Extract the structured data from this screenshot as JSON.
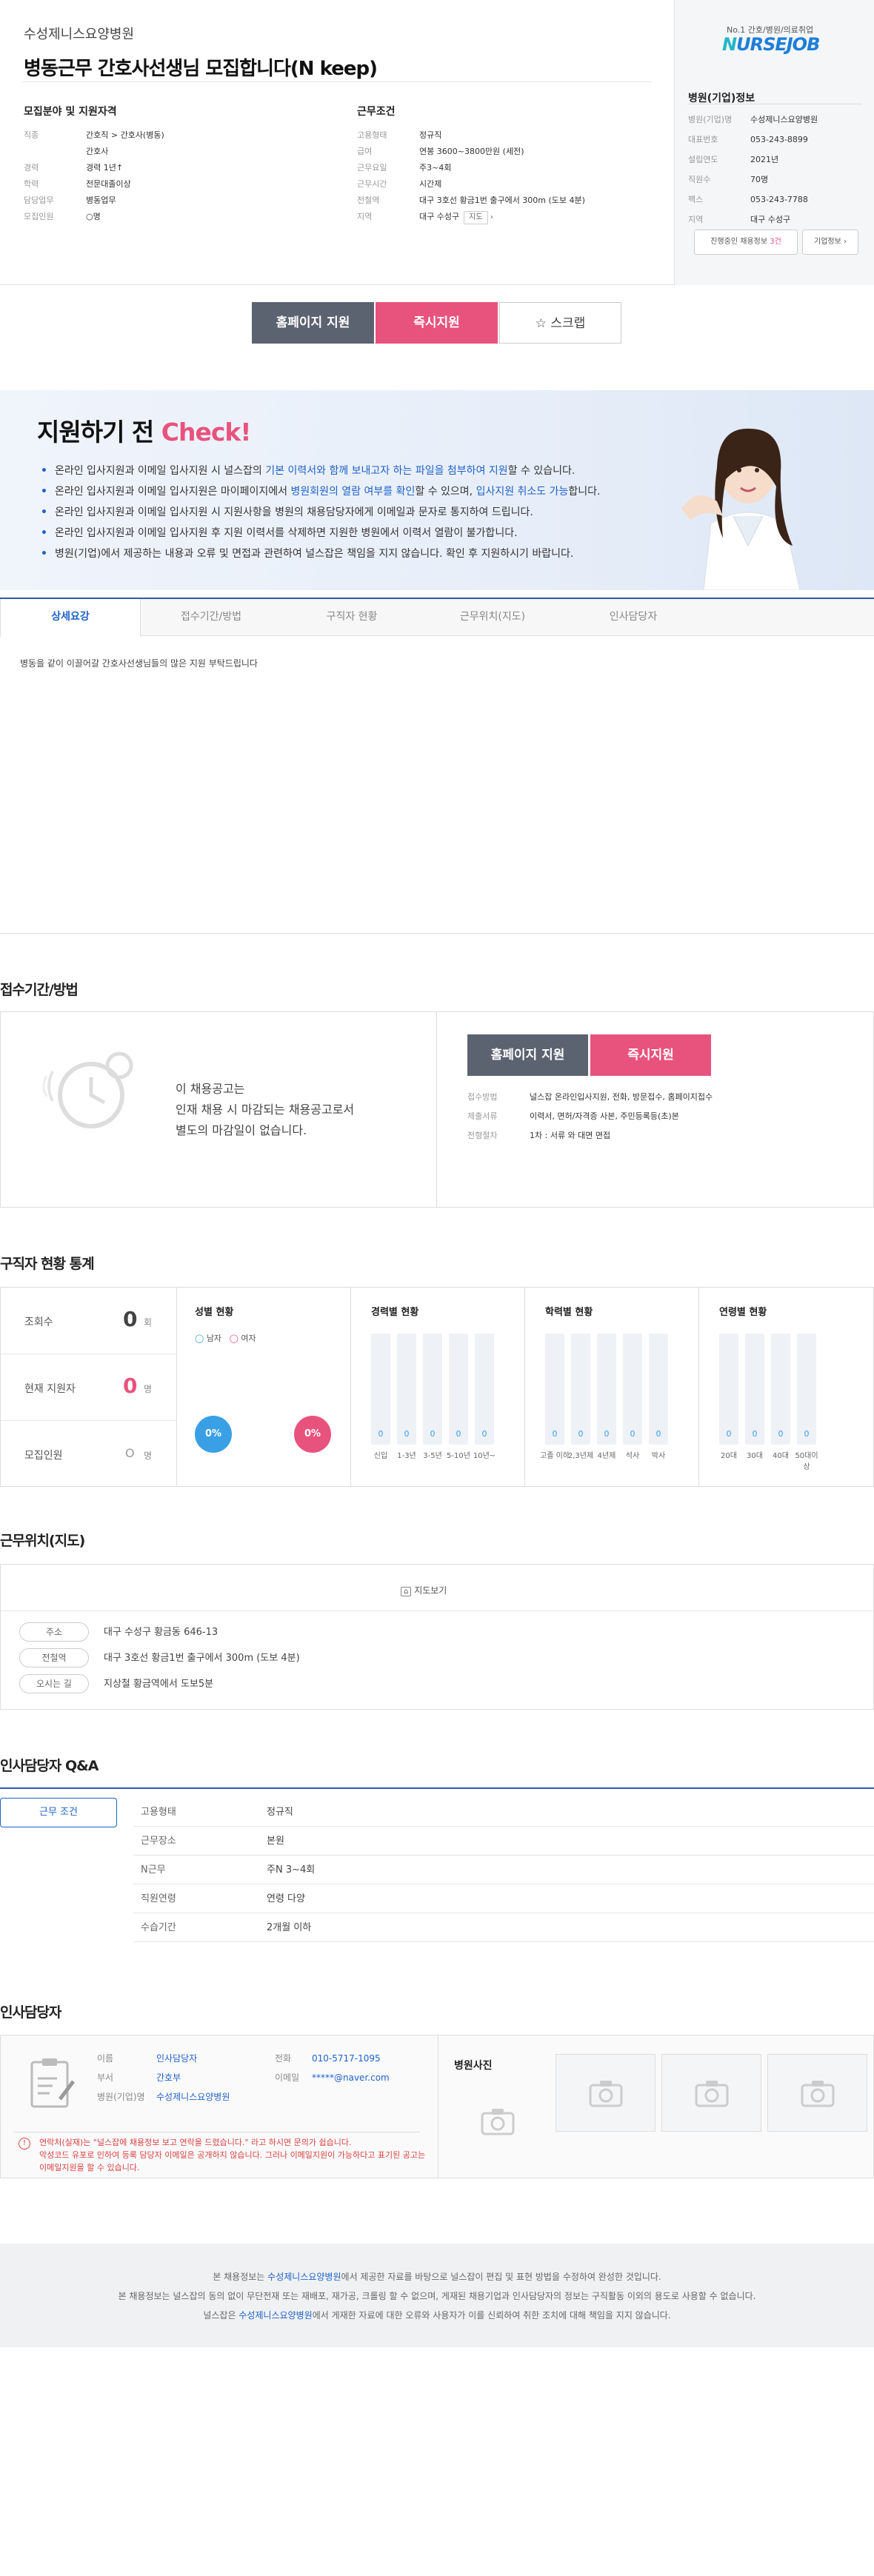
{
  "header": {
    "hospital_name": "수성제니스요양병원",
    "job_title": "병동근무 간호사선생님 모집합니다(N keep)"
  },
  "qualifications": {
    "heading": "모집분야 및 지원자격",
    "rows": [
      {
        "k": "직종",
        "v": "간호직 > 간호사(병동)"
      },
      {
        "k": "",
        "v": "간호사"
      },
      {
        "k": "경력",
        "v": "경력 1년↑"
      },
      {
        "k": "학력",
        "v": "전문대졸이상"
      },
      {
        "k": "담당업무",
        "v": "병동업무"
      },
      {
        "k": "모집인원",
        "v": "○명"
      }
    ]
  },
  "conditions": {
    "heading": "근무조건",
    "rows": [
      {
        "k": "고용형태",
        "v": "정규직"
      },
      {
        "k": "급여",
        "v": "연봉 3600~3800만원 (세전)"
      },
      {
        "k": "근무요일",
        "v": "주3~4회"
      },
      {
        "k": "근무시간",
        "v": "시간제"
      },
      {
        "k": "전철역",
        "v_highlight": "대구 3호선",
        "v": " 황금1번 출구에서 300m (도보 4분)"
      },
      {
        "k": "지역",
        "v": "대구 수성구",
        "map_button": "지도"
      }
    ]
  },
  "company": {
    "logo_sub": "No.1 간호/병원/의료취업",
    "logo_a": "N",
    "logo_b": "URSEJOB",
    "heading": "병원(기업)정보",
    "rows": [
      {
        "k": "병원(기업)명",
        "v": "수성제니스요양병원"
      },
      {
        "k": "대표번호",
        "v": "053-243-8899"
      },
      {
        "k": "설립연도",
        "v": "2021년"
      },
      {
        "k": "직원수",
        "v": "70명"
      },
      {
        "k": "팩스",
        "v": "053-243-7788"
      },
      {
        "k": "지역",
        "v": "대구 수성구"
      }
    ],
    "ongoing_button": "진행중인 채용정보",
    "ongoing_count": "3건",
    "info_button": "기업정보 ›"
  },
  "actions": {
    "homepage": "홈페이지 지원",
    "apply": "즉시지원",
    "scrap": "스크랩"
  },
  "check": {
    "title_a": "지원하기 전 ",
    "title_b": "Check!",
    "items": [
      {
        "a": "온라인 입사지원과 이메일 입사지원 시 널스잡의 ",
        "h": "기본 이력서와 함께 보내고자 하는 파일을 첨부하여 지원",
        "c": "할 수 있습니다."
      },
      {
        "a": "온라인 입사지원과 이메일 입사지원은 마이페이지에서 ",
        "h": "병원회원의 열람 여부를 확인",
        "c": "할 수 있으며, ",
        "h2": "입사지원 취소도 가능",
        "d": "합니다."
      },
      {
        "a": "온라인 입사지원과 이메일 입사지원 시 지원사항을 병원의 채용담당자에게 이메일과 문자로 통지하여 드립니다.",
        "h": "",
        "c": ""
      },
      {
        "a": "온라인 입사지원과 이메일 입사지원 후 지원 이력서를 삭제하면 지원한 병원에서 이력서 열람이 불가합니다.",
        "h": "",
        "c": ""
      },
      {
        "a": "병원(기업)에서 제공하는 내용과 오류 및 면접과 관련하여 널스잡은 책임을 지지 않습니다. 확인 후 지원하시기 바랍니다.",
        "h": "",
        "c": ""
      }
    ]
  },
  "tabs": [
    "상세요강",
    "접수기간/방법",
    "구직자 현황",
    "근무위치(지도)",
    "인사담당자"
  ],
  "detail_text": "병동을 같이 이끌어갈 간호사선생님들의 많은 지원 부탁드립니다",
  "reception": {
    "title": "접수기간/방법",
    "notice_lines": [
      "이 채용공고는",
      "인재 채용 시 마감되는 채용공고로서",
      "별도의 마감일이 없습니다."
    ],
    "homepage": "홈페이지 지원",
    "apply": "즉시지원",
    "rows": [
      {
        "k": "접수방법",
        "v": "널스잡 온라인입사지원, 전화, 방문접수, 홈페이지접수"
      },
      {
        "k": "제출서류",
        "v": "이력서, 면허/자격증 사본, 주민등록등(초)본"
      },
      {
        "k": "전형절차",
        "v": "1차 : 서류 와 대면 면접"
      }
    ]
  },
  "stats": {
    "title": "구직자 현황 통계",
    "views_label": "조회수",
    "views_value": "0",
    "views_unit": "회",
    "applicants_label": "현재 지원자",
    "applicants_value": "0",
    "applicants_unit": "명",
    "recruit_label": "모집인원",
    "recruit_value": "O",
    "recruit_unit": "명",
    "gender_title": "성별 현황",
    "male": "남자",
    "female": "여자",
    "male_pct": "0%",
    "female_pct": "0%",
    "groups": [
      {
        "title": "경력별 현황",
        "labels": [
          "신입",
          "1-3년",
          "3-5년",
          "5-10년",
          "10년~"
        ],
        "values": [
          0,
          0,
          0,
          0,
          0
        ]
      },
      {
        "title": "학력별 현황",
        "labels": [
          "고졸 이하",
          "2,3년제",
          "4년제",
          "석사",
          "박사"
        ],
        "values": [
          0,
          0,
          0,
          0,
          0
        ]
      },
      {
        "title": "연령별 현황",
        "labels": [
          "20대",
          "30대",
          "40대",
          "50대이상"
        ],
        "values": [
          0,
          0,
          0,
          0
        ]
      }
    ]
  },
  "location": {
    "title": "근무위치(지도)",
    "map_view": "지도보기",
    "rows": [
      {
        "k": "주소",
        "v": "대구 수성구 황금동 646-13"
      },
      {
        "k": "전철역",
        "v": "대구 3호선 황금1번 출구에서 300m (도보 4분)"
      },
      {
        "k": "오시는 길",
        "v": "지상철 황금역에서 도보5분"
      }
    ]
  },
  "qa": {
    "title": "인사담당자 Q&A",
    "tab": "근무 조건",
    "rows": [
      {
        "k": "고용형태",
        "v": "정규직"
      },
      {
        "k": "근무장소",
        "v": "본원"
      },
      {
        "k": "N근무",
        "v": "주N 3~4회"
      },
      {
        "k": "직원연령",
        "v": "연령 다양"
      },
      {
        "k": "수습기간",
        "v": "2개월 이하"
      }
    ]
  },
  "manager": {
    "title": "인사담당자",
    "name_k": "이름",
    "name_v": "인사담당자",
    "dept_k": "부서",
    "dept_v": "간호부",
    "company_k": "병원(기업)명",
    "company_v": "수성제니스요양병원",
    "phone_k": "전화",
    "phone_v": "010-5717-1095",
    "email_k": "이메일",
    "email_v": "*****@naver.com",
    "photos_title": "병원사진",
    "warning_lines": [
      "연락처(실재)는 \"널스잡에 채용정보 보고 연락을 드렸습니다.\" 라고 하시면 문의가 쉽습니다.",
      "악성코드 유포로 인하여 등록 담당자 이메일은 공개하지 않습니다. 그러나 이메일지원이 가능하다고 표기된 공고는",
      "이메일지원을 할 수 있습니다."
    ]
  },
  "footer": {
    "l1a": "본 채용정보는 ",
    "l1h": "수성제니스요양병원",
    "l1b": "에서 제공한 자료를 바탕으로 널스잡이 편집 및 표현 방법을 수정하여 완성한 것입니다.",
    "l2": "본 채용정보는 널스잡의 동의 없이 무단전재 또는 재배포, 재가공, 크롤링 할 수 없으며, 게재된 채용기업과 인사담당자의 정보는 구직활동 이외의 용도로 사용할 수 없습니다.",
    "l3a": "널스잡은 ",
    "l3h": "수성제니스요양병원",
    "l3b": "에서 게재한 자료에 대한 오류와 사용자가 이를 신뢰하여 취한 조치에 대해 책임을 지지 않습니다."
  },
  "colors": {
    "accent_blue": "#1e62c8",
    "pink": "#e8537d",
    "dark_button": "#5b6270"
  }
}
